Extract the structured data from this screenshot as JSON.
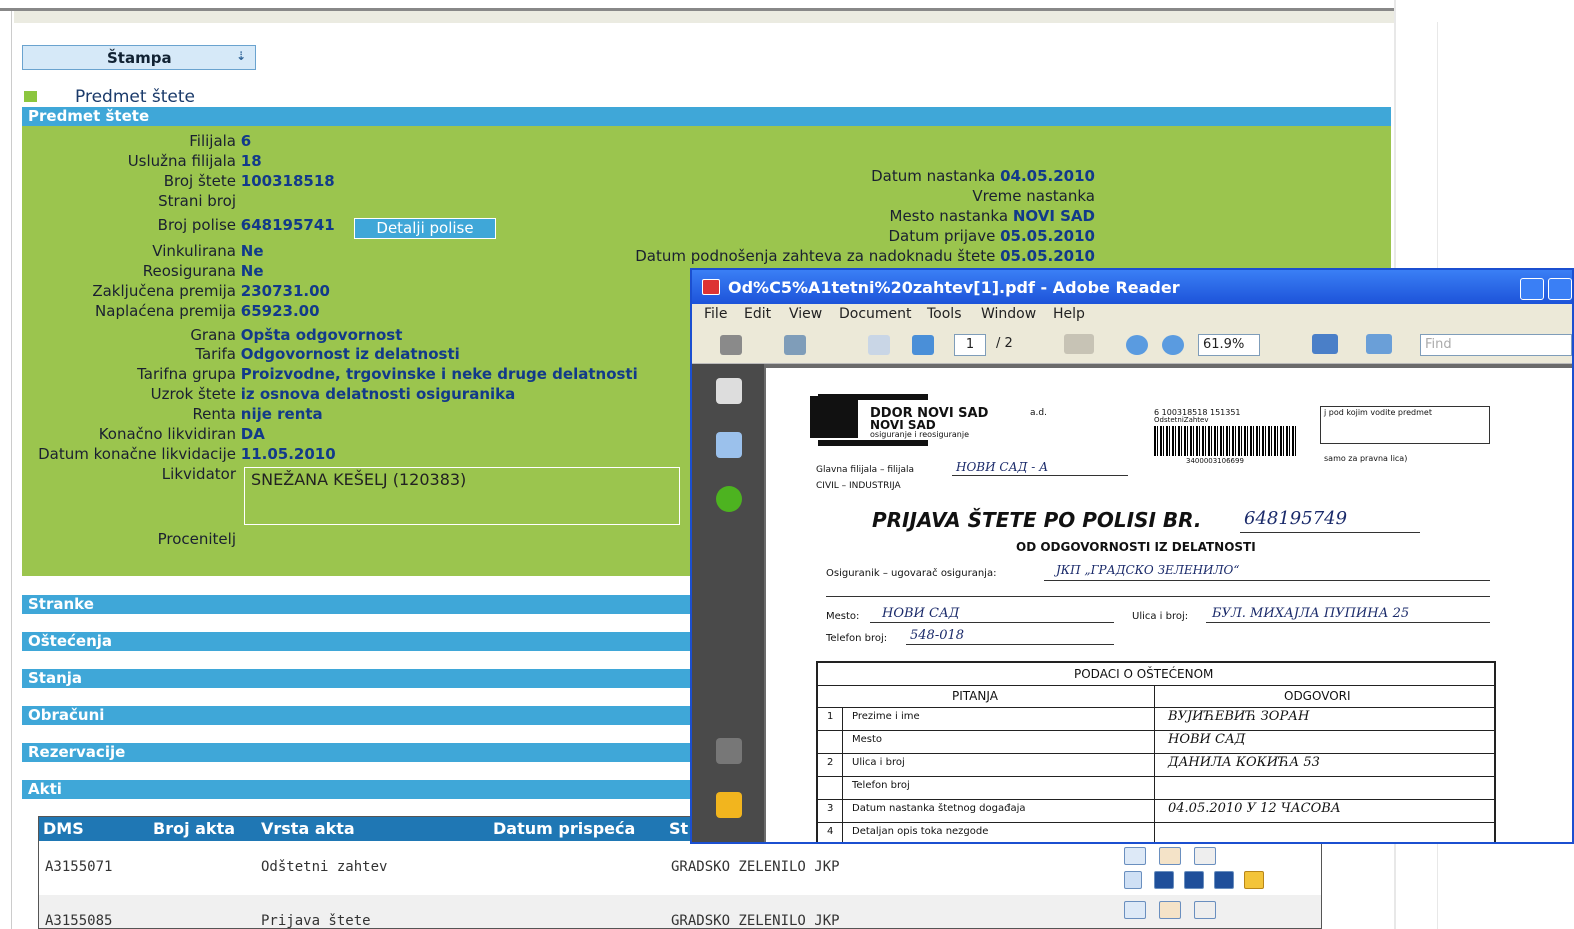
{
  "toolbar_left": {
    "print_label": "Štampa"
  },
  "section_title": "Predmet štete",
  "section_bar": "Predmet štete",
  "left_fields": [
    {
      "label": "Filijala",
      "value": "6"
    },
    {
      "label": "Uslužna filijala",
      "value": "18"
    },
    {
      "label": "Broj štete",
      "value": "100318518"
    },
    {
      "label": "Strani broj",
      "value": ""
    },
    {
      "label": "Broj polise",
      "value": "648195741"
    },
    {
      "label": "Vinkulirana",
      "value": "Ne"
    },
    {
      "label": "Reosigurana",
      "value": "Ne"
    },
    {
      "label": "Zaključena premija",
      "value": "230731.00"
    },
    {
      "label": "Naplaćena premija",
      "value": "65923.00"
    },
    {
      "label": "Grana",
      "value": "Opšta odgovornost"
    },
    {
      "label": "Tarifa",
      "value": "Odgovornost iz delatnosti"
    },
    {
      "label": "Tarifna grupa",
      "value": "Proizvodne, trgovinske i neke druge delatnosti"
    },
    {
      "label": "Uzrok štete",
      "value": "iz osnova delatnosti osiguranika"
    },
    {
      "label": "Renta",
      "value": "nije renta"
    },
    {
      "label": "Konačno likvidiran",
      "value": "DA"
    },
    {
      "label": "Datum konačne likvidacije",
      "value": "11.05.2010"
    }
  ],
  "likvidator": {
    "label": "Likvidator",
    "value": "SNEŽANA KEŠELJ (120383)"
  },
  "procenitelj_label": "Procenitelj",
  "policy_details_button": "Detalji polise",
  "right_fields": [
    {
      "label": "Datum nastanka",
      "value": "04.05.2010"
    },
    {
      "label": "Vreme nastanka",
      "value": ""
    },
    {
      "label": "Mesto nastanka",
      "value": "NOVI SAD"
    },
    {
      "label": "Datum prijave",
      "value": "05.05.2010"
    },
    {
      "label": "Datum podnošenja zahteva za nadoknadu štete",
      "value": "05.05.2010"
    }
  ],
  "section_bars": [
    "Stranke",
    "Oštećenja",
    "Stanja",
    "Obračuni",
    "Rezervacije",
    "Akti"
  ],
  "acts_table": {
    "headers": [
      "DMS",
      "Broj akta",
      "Vrsta akta",
      "Datum prispeća",
      "St"
    ],
    "rows": [
      {
        "dms": "A3155071",
        "type": "Odštetni zahtev",
        "party": "GRADSKO ZELENILO JKP"
      },
      {
        "dms": "A3155085",
        "type": "Prijava štete",
        "party": "GRADSKO ZELENILO JKP"
      }
    ]
  },
  "pdf_window": {
    "title": "Od%C5%A1tetni%20zahtev[1].pdf - Adobe Reader",
    "menu": [
      "File",
      "Edit",
      "View",
      "Document",
      "Tools",
      "Window",
      "Help"
    ],
    "page_current": "1",
    "page_total": "/ 2",
    "zoom": "61.9%",
    "find_placeholder": "Find",
    "doc": {
      "company_line1": "DDOR NOVI SAD",
      "company_suffix": "a.d.",
      "company_line2": "NOVI SAD",
      "company_line3": "osiguranje i reosiguranje",
      "barcode_top": "6 100318518 151351",
      "barcode_sub": "OdstetniZahtev",
      "barcode_num": "3400003106699",
      "box_note": "j pod kojim vodite predmet",
      "box_note2": "samo za pravna lica)",
      "branch_label": "Glavna filijala – filijala",
      "branch_hw": "НОВИ САД - А",
      "branch_sub": "CIVIL – INDUSTRIJA",
      "heading": "PRIJAVA ŠTETE PO POLISI BR.",
      "heading_hw": "648195749",
      "subheading": "OD ODGOVORNOSTI IZ DELATNOSTI",
      "insured_label": "Osiguranik – ugovarač osiguranja:",
      "insured_hw": "ЈКП „ГРАДСКО ЗЕЛЕНИЛО“",
      "place_label": "Mesto:",
      "place_hw": "НОВИ САД",
      "street_label": "Ulica i broj:",
      "street_hw": "БУЛ. МИХАЈЛА ПУПИНА 25",
      "phone_label": "Telefon broj:",
      "phone_hw": "548-018",
      "table_title": "PODACI O OŠTEĆENOM",
      "col_q": "PITANJA",
      "col_a": "ODGOVORI",
      "rows": [
        {
          "n": "1",
          "q": "Prezime i ime",
          "a": "ВУЈИЋЕВИЋ ЗОРАН"
        },
        {
          "n": "",
          "q": "Mesto",
          "a": "НОВИ САД"
        },
        {
          "n": "2",
          "q": "Ulica i broj",
          "a": "ДАНИЛА КОКИЋА 53"
        },
        {
          "n": "",
          "q": "Telefon broj",
          "a": ""
        },
        {
          "n": "3",
          "q": "Datum nastanka štetnog događaja",
          "a": "04.05.2010 У 12 ЧАСОВА"
        },
        {
          "n": "4",
          "q": "Detaljan opis toka nezgode",
          "a": ""
        }
      ]
    }
  }
}
